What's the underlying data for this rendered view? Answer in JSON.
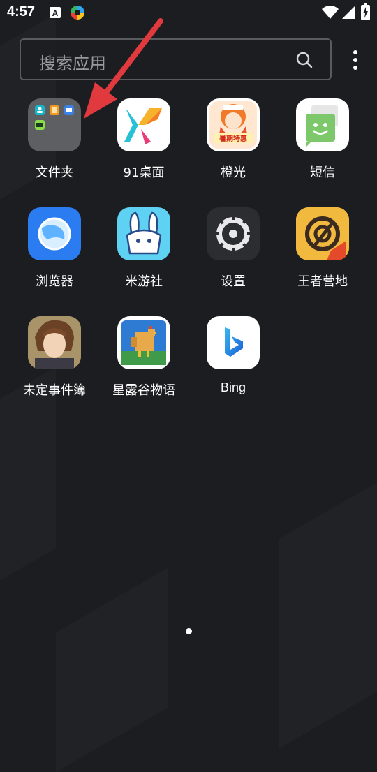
{
  "status_bar": {
    "time": "4:57",
    "notification_icons": [
      "text-a-icon",
      "colorful-ring-icon"
    ],
    "system_icons": [
      "wifi-icon",
      "cellular-signal-icon",
      "battery-charging-icon"
    ]
  },
  "search": {
    "placeholder": "搜索应用"
  },
  "apps": [
    {
      "label": "文件夹",
      "icon": "folder-icon"
    },
    {
      "label": "91桌面",
      "icon": "91-launcher-icon"
    },
    {
      "label": "橙光",
      "icon": "chengguang-icon"
    },
    {
      "label": "短信",
      "icon": "sms-icon"
    },
    {
      "label": "浏览器",
      "icon": "browser-icon"
    },
    {
      "label": "米游社",
      "icon": "miyoushe-icon"
    },
    {
      "label": "设置",
      "icon": "settings-icon"
    },
    {
      "label": "王者营地",
      "icon": "wangzhe-camp-icon"
    },
    {
      "label": "未定事件簿",
      "icon": "weiding-icon"
    },
    {
      "label": "星露谷物语",
      "icon": "stardew-valley-icon"
    },
    {
      "label": "Bing",
      "icon": "bing-icon"
    }
  ],
  "chengguang_banner": "暑期特惠",
  "colors": {
    "background": "#1c1d21",
    "arrow": "#e03a3e",
    "label": "#ffffff"
  }
}
